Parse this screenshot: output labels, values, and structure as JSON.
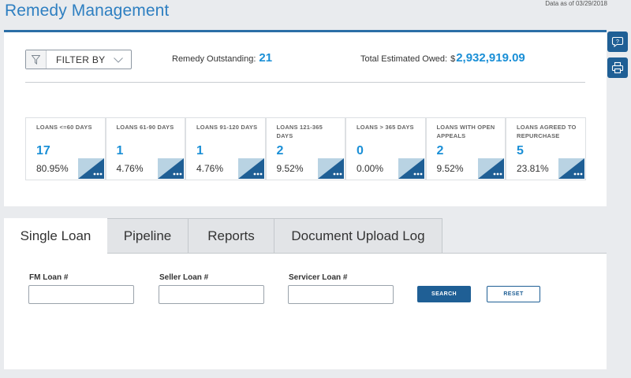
{
  "page": {
    "title": "Remedy Management",
    "data_as_of": "Data as of 03/29/2018"
  },
  "filter": {
    "label": "FILTER BY",
    "icon": "filter-funnel-icon"
  },
  "summary": {
    "remedy_outstanding_label": "Remedy Outstanding:",
    "remedy_outstanding_value": "21",
    "total_owed_label": "Total Estimated Owed:",
    "total_owed_currency": "$",
    "total_owed_value": "2,932,919.09"
  },
  "cards": [
    {
      "title": "LOANS <=60 DAYS",
      "count": "17",
      "percent": "80.95%"
    },
    {
      "title": "LOANS 61-90 DAYS",
      "count": "1",
      "percent": "4.76%"
    },
    {
      "title": "LOANS 91-120 DAYS",
      "count": "1",
      "percent": "4.76%"
    },
    {
      "title": "LOANS 121-365 DAYS",
      "count": "2",
      "percent": "9.52%"
    },
    {
      "title": "LOANS > 365 DAYS",
      "count": "0",
      "percent": "0.00%"
    },
    {
      "title": "LOANS WITH OPEN APPEALS",
      "count": "2",
      "percent": "9.52%"
    },
    {
      "title": "LOANS AGREED TO REPURCHASE",
      "count": "5",
      "percent": "23.81%"
    }
  ],
  "side_buttons": {
    "help_icon": "help-question-icon",
    "print_icon": "printer-icon"
  },
  "tabs": [
    {
      "label": "Single Loan",
      "active": true
    },
    {
      "label": "Pipeline",
      "active": false
    },
    {
      "label": "Reports",
      "active": false
    },
    {
      "label": "Document Upload Log",
      "active": false
    }
  ],
  "search_form": {
    "fm_loan_label": "FM Loan #",
    "fm_loan_value": "",
    "seller_loan_label": "Seller Loan #",
    "seller_loan_value": "",
    "servicer_loan_label": "Servicer Loan #",
    "servicer_loan_value": "",
    "search_label": "SEARCH",
    "reset_label": "RESET"
  },
  "colors": {
    "accent_blue": "#1a8fd6",
    "title_blue": "#2e7fc1",
    "dark_blue": "#1f5f95",
    "card_triangle_light": "#b9d3e3"
  }
}
